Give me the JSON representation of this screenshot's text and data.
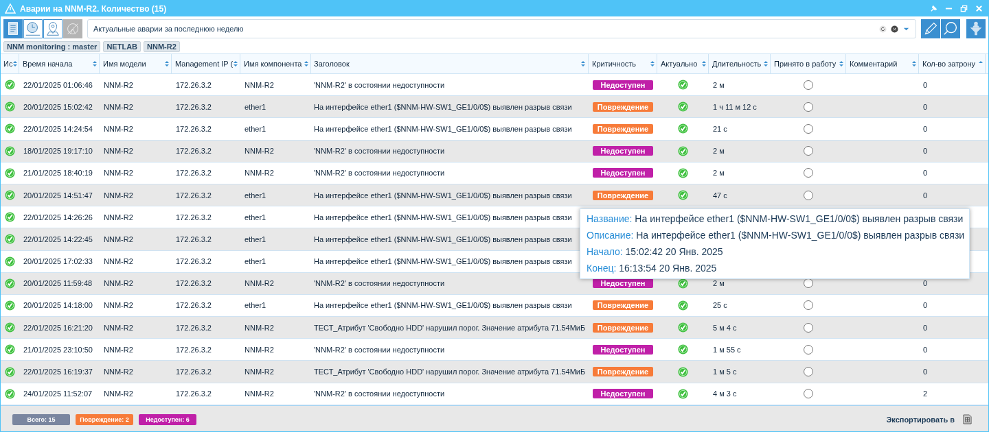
{
  "window": {
    "title": "Аварии на NNM-R2. Количество (15)"
  },
  "filter": {
    "value": "Актуальные аварии за последнюю неделю"
  },
  "tags": [
    "NNM monitoring : master",
    "NETLAB",
    "NNM-R2"
  ],
  "columns": [
    "Ис",
    "Время начала",
    "Имя модели",
    "Management IP (",
    "Имя компонента",
    "Заголовок",
    "Критичность",
    "Актуально",
    "Длительность",
    "Принято в работу",
    "Комментарий",
    "Кол-во затрону"
  ],
  "rows": [
    {
      "time": "22/01/2025 01:06:46",
      "model": "NNM-R2",
      "ip": "172.26.3.2",
      "component": "NNM-R2",
      "title": "'NNM-R2' в состоянии недоступности",
      "severity": {
        "label": "Недоступен",
        "color": "#c020a8"
      },
      "actual": true,
      "duration": "2 м",
      "accepted": false,
      "count": "0"
    },
    {
      "time": "20/01/2025 15:02:42",
      "model": "NNM-R2",
      "ip": "172.26.3.2",
      "component": "ether1",
      "title": "На интерфейсе ether1 ($NNM-HW-SW1_GE1/0/0$) выявлен разрыв связи",
      "severity": {
        "label": "Повреждение",
        "color": "#f77b39"
      },
      "actual": true,
      "duration": "1 ч 11 м 12 с",
      "accepted": false,
      "count": "0"
    },
    {
      "time": "22/01/2025 14:24:54",
      "model": "NNM-R2",
      "ip": "172.26.3.2",
      "component": "ether1",
      "title": "На интерфейсе ether1 ($NNM-HW-SW1_GE1/0/0$) выявлен разрыв связи",
      "severity": {
        "label": "Повреждение",
        "color": "#f77b39"
      },
      "actual": true,
      "duration": "21 с",
      "accepted": false,
      "count": "0"
    },
    {
      "time": "18/01/2025 19:17:10",
      "model": "NNM-R2",
      "ip": "172.26.3.2",
      "component": "NNM-R2",
      "title": "'NNM-R2' в состоянии недоступности",
      "severity": {
        "label": "Недоступен",
        "color": "#c020a8"
      },
      "actual": true,
      "duration": "2 м",
      "accepted": false,
      "count": "0"
    },
    {
      "time": "21/01/2025 18:40:19",
      "model": "NNM-R2",
      "ip": "172.26.3.2",
      "component": "NNM-R2",
      "title": "'NNM-R2' в состоянии недоступности",
      "severity": {
        "label": "Недоступен",
        "color": "#c020a8"
      },
      "actual": true,
      "duration": "2 м",
      "accepted": false,
      "count": "0"
    },
    {
      "time": "20/01/2025 14:51:47",
      "model": "NNM-R2",
      "ip": "172.26.3.2",
      "component": "ether1",
      "title": "На интерфейсе ether1 ($NNM-HW-SW1_GE1/0/0$) выявлен разрыв связи",
      "severity": {
        "label": "Повреждение",
        "color": "#f77b39"
      },
      "actual": true,
      "duration": "47 с",
      "accepted": false,
      "count": "0"
    },
    {
      "time": "22/01/2025 14:26:26",
      "model": "NNM-R2",
      "ip": "172.26.3.2",
      "component": "ether1",
      "title": "На интерфейсе ether1 ($NNM-HW-SW1_GE1/0/0$) выявлен разрыв связи"
    },
    {
      "time": "22/01/2025 14:22:45",
      "model": "NNM-R2",
      "ip": "172.26.3.2",
      "component": "ether1",
      "title": "На интерфейсе ether1 ($NNM-HW-SW1_GE1/0/0$) выявлен разрыв связи"
    },
    {
      "time": "20/01/2025 17:02:33",
      "model": "NNM-R2",
      "ip": "172.26.3.2",
      "component": "ether1",
      "title": "На интерфейсе ether1 ($NNM-HW-SW1_GE1/0/0$) выявлен разрыв связи"
    },
    {
      "time": "20/01/2025 11:59:48",
      "model": "NNM-R2",
      "ip": "172.26.3.2",
      "component": "NNM-R2",
      "title": "'NNM-R2' в состоянии недоступности",
      "severity": {
        "label": "Недоступен",
        "color": "#c020a8"
      },
      "actual": true,
      "duration": "2 м",
      "accepted": false,
      "count": "0"
    },
    {
      "time": "20/01/2025 14:18:00",
      "model": "NNM-R2",
      "ip": "172.26.3.2",
      "component": "ether1",
      "title": "На интерфейсе ether1 ($NNM-HW-SW1_GE1/0/0$) выявлен разрыв связи",
      "severity": {
        "label": "Повреждение",
        "color": "#f77b39"
      },
      "actual": true,
      "duration": "25 с",
      "accepted": false,
      "count": "0"
    },
    {
      "time": "22/01/2025 16:21:20",
      "model": "NNM-R2",
      "ip": "172.26.3.2",
      "component": "NNM-R2",
      "title": "ТЕСТ_Атрибут 'Свободно HDD' нарушил порог. Значение атрибута 71.54МиБ",
      "severity": {
        "label": "Повреждение",
        "color": "#f77b39"
      },
      "actual": true,
      "duration": "5 м 4 с",
      "accepted": false,
      "count": "0"
    },
    {
      "time": "21/01/2025 23:10:50",
      "model": "NNM-R2",
      "ip": "172.26.3.2",
      "component": "NNM-R2",
      "title": "'NNM-R2' в состоянии недоступности",
      "severity": {
        "label": "Недоступен",
        "color": "#c020a8"
      },
      "actual": true,
      "duration": "1 м 55 с",
      "accepted": false,
      "count": "0"
    },
    {
      "time": "22/01/2025 16:19:37",
      "model": "NNM-R2",
      "ip": "172.26.3.2",
      "component": "NNM-R2",
      "title": "ТЕСТ_Атрибут 'Свободно HDD' нарушил порог. Значение атрибута 71.54МиБ",
      "severity": {
        "label": "Повреждение",
        "color": "#f77b39"
      },
      "actual": true,
      "duration": "1 м 5 с",
      "accepted": false,
      "count": "0"
    },
    {
      "time": "24/01/2025 11:52:07",
      "model": "NNM-R2",
      "ip": "172.26.3.2",
      "component": "NNM-R2",
      "title": "'NNM-R2' в состоянии недоступности",
      "severity": {
        "label": "Недоступен",
        "color": "#c020a8"
      },
      "actual": true,
      "duration": "4 м 3 с",
      "accepted": false,
      "count": "2"
    }
  ],
  "tooltip": [
    {
      "label": "Название:",
      "value": "На интерфейсе ether1 ($NNM-HW-SW1_GE1/0/0$) выявлен разрыв связи"
    },
    {
      "label": "Описание:",
      "value": "На интерфейсе ether1 ($NNM-HW-SW1_GE1/0/0$) выявлен разрыв связи"
    },
    {
      "label": "Начало:",
      "value": "15:02:42 20 Янв. 2025"
    },
    {
      "label": "Конец:",
      "value": "16:13:54 20 Янв. 2025"
    }
  ],
  "summary": [
    {
      "label": "Всего: 15",
      "color": "#7a86a0"
    },
    {
      "label": "Повреждение: 2",
      "color": "#f77b39"
    },
    {
      "label": "Недоступен: 6",
      "color": "#c020a8"
    }
  ],
  "export": {
    "label": "Экспортировать в"
  }
}
